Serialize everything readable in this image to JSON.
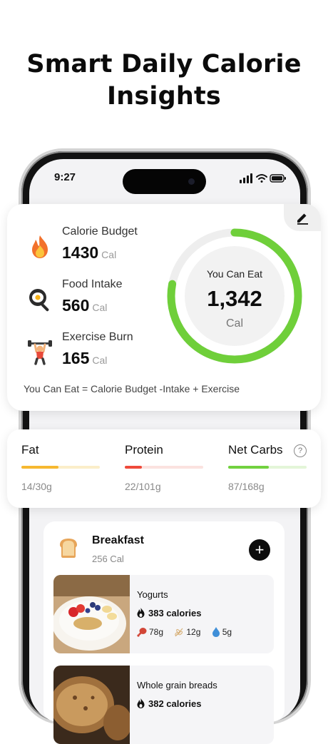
{
  "headline": {
    "line1": "Smart Daily Calorie",
    "line2": "Insights"
  },
  "status_bar": {
    "time": "9:27"
  },
  "summary": {
    "stats": [
      {
        "label": "Calorie Budget",
        "value": "1430",
        "unit": "Cal",
        "icon": "fire-icon"
      },
      {
        "label": "Food Intake",
        "value": "560",
        "unit": "Cal",
        "icon": "frying-pan-icon"
      },
      {
        "label": "Exercise Burn",
        "value": "165",
        "unit": "Cal",
        "icon": "weightlifter-icon"
      }
    ],
    "ring": {
      "title": "You Can Eat",
      "value": "1,342",
      "unit": "Cal",
      "progress": 0.78,
      "color": "#6fcf3a"
    },
    "formula": "You Can Eat = Calorie Budget -Intake + Exercise"
  },
  "macros": [
    {
      "name": "Fat",
      "value": "14/30g",
      "progress": 0.47,
      "color": "#f6b830",
      "track": "#fbeec9"
    },
    {
      "name": "Protein",
      "value": "22/101g",
      "progress": 0.22,
      "color": "#ef4a3b",
      "track": "#fbe2df"
    },
    {
      "name": "Net Carbs",
      "value": "87/168g",
      "progress": 0.52,
      "color": "#72d13f",
      "track": "#e3f5d8"
    }
  ],
  "meal": {
    "title": "Breakfast",
    "calories": "256 Cal",
    "foods": [
      {
        "name": "Yogurts",
        "calories": "383 calories",
        "protein": "78g",
        "carbs": "12g",
        "fat": "5g"
      },
      {
        "name": "Whole grain breads",
        "calories": "382 calories"
      }
    ]
  }
}
